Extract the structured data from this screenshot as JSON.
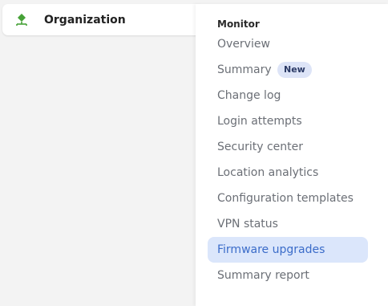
{
  "organization": {
    "label": "Organization",
    "icon": "organization-network-icon",
    "icon_color": "#46a137"
  },
  "menu": {
    "header": "Monitor",
    "items": [
      {
        "label": "Overview"
      },
      {
        "label": "Summary",
        "badge": "New"
      },
      {
        "label": "Change log"
      },
      {
        "label": "Login attempts"
      },
      {
        "label": "Security center"
      },
      {
        "label": "Location analytics"
      },
      {
        "label": "Configuration templates"
      },
      {
        "label": "VPN status"
      },
      {
        "label": "Firmware upgrades",
        "selected": true
      },
      {
        "label": "Summary report"
      }
    ]
  },
  "colors": {
    "selected_bg": "#dbe6fb",
    "selected_text": "#3b6cc9",
    "badge_bg": "#dde4f7"
  }
}
